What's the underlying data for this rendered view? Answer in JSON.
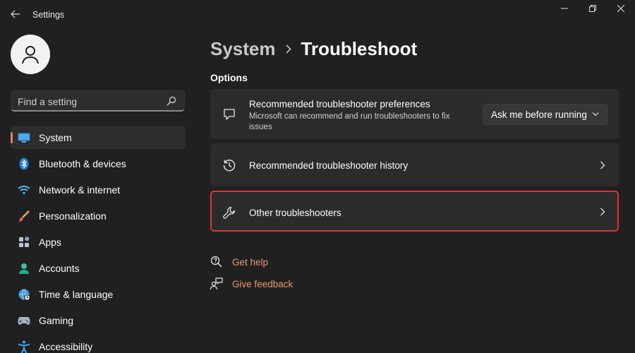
{
  "window": {
    "title": "Settings"
  },
  "search": {
    "placeholder": "Find a setting"
  },
  "sidebar": {
    "items": [
      {
        "label": "System",
        "icon": "monitor-icon",
        "active": true
      },
      {
        "label": "Bluetooth & devices",
        "icon": "bluetooth-icon"
      },
      {
        "label": "Network & internet",
        "icon": "wifi-icon"
      },
      {
        "label": "Personalization",
        "icon": "brush-icon"
      },
      {
        "label": "Apps",
        "icon": "apps-icon"
      },
      {
        "label": "Accounts",
        "icon": "person-icon"
      },
      {
        "label": "Time & language",
        "icon": "globe-clock-icon"
      },
      {
        "label": "Gaming",
        "icon": "controller-icon"
      },
      {
        "label": "Accessibility",
        "icon": "accessibility-icon"
      }
    ]
  },
  "breadcrumb": {
    "parent": "System",
    "current": "Troubleshoot"
  },
  "main": {
    "section_label": "Options",
    "cards": [
      {
        "title": "Recommended troubleshooter preferences",
        "description": "Microsoft can recommend and run troubleshooters to fix issues",
        "dropdown_value": "Ask me before running",
        "icon": "chat-bubble-icon"
      },
      {
        "title": "Recommended troubleshooter history",
        "icon": "history-icon"
      },
      {
        "title": "Other troubleshooters",
        "icon": "wrench-icon",
        "highlighted": true
      }
    ],
    "links": [
      {
        "label": "Get help",
        "icon": "help-icon"
      },
      {
        "label": "Give feedback",
        "icon": "feedback-icon"
      }
    ]
  },
  "colors": {
    "background": "#202020",
    "card": "#2b2b2b",
    "accent": "#e27d60",
    "link": "#e8996e",
    "highlight_border": "#e0303a"
  }
}
